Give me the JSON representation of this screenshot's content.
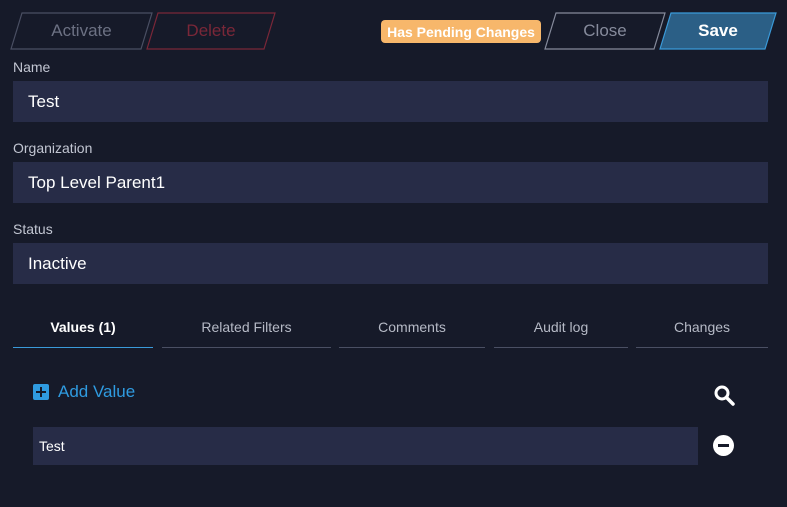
{
  "toolbar": {
    "activate_label": "Activate",
    "delete_label": "Delete",
    "pending_badge": "Has Pending Changes",
    "close_label": "Close",
    "save_label": "Save"
  },
  "fields": {
    "name": {
      "label": "Name",
      "value": "Test"
    },
    "organization": {
      "label": "Organization",
      "value": "Top Level Parent1"
    },
    "status": {
      "label": "Status",
      "value": "Inactive"
    }
  },
  "tabs": [
    {
      "label": "Values (1)",
      "active": true
    },
    {
      "label": "Related Filters",
      "active": false
    },
    {
      "label": "Comments",
      "active": false
    },
    {
      "label": "Audit log",
      "active": false
    },
    {
      "label": "Changes",
      "active": false
    }
  ],
  "values_panel": {
    "add_label": "Add Value",
    "items": [
      "Test"
    ]
  },
  "colors": {
    "background": "#161a29",
    "field_bg": "#272c47",
    "accent": "#2f9be0",
    "save_bg": "#2b5f86",
    "pending_badge": "#f7b76b",
    "delete_border": "#7a2738"
  },
  "icons": {
    "add": "plus-square-icon",
    "search": "search-icon",
    "remove": "minus-circle-icon"
  }
}
